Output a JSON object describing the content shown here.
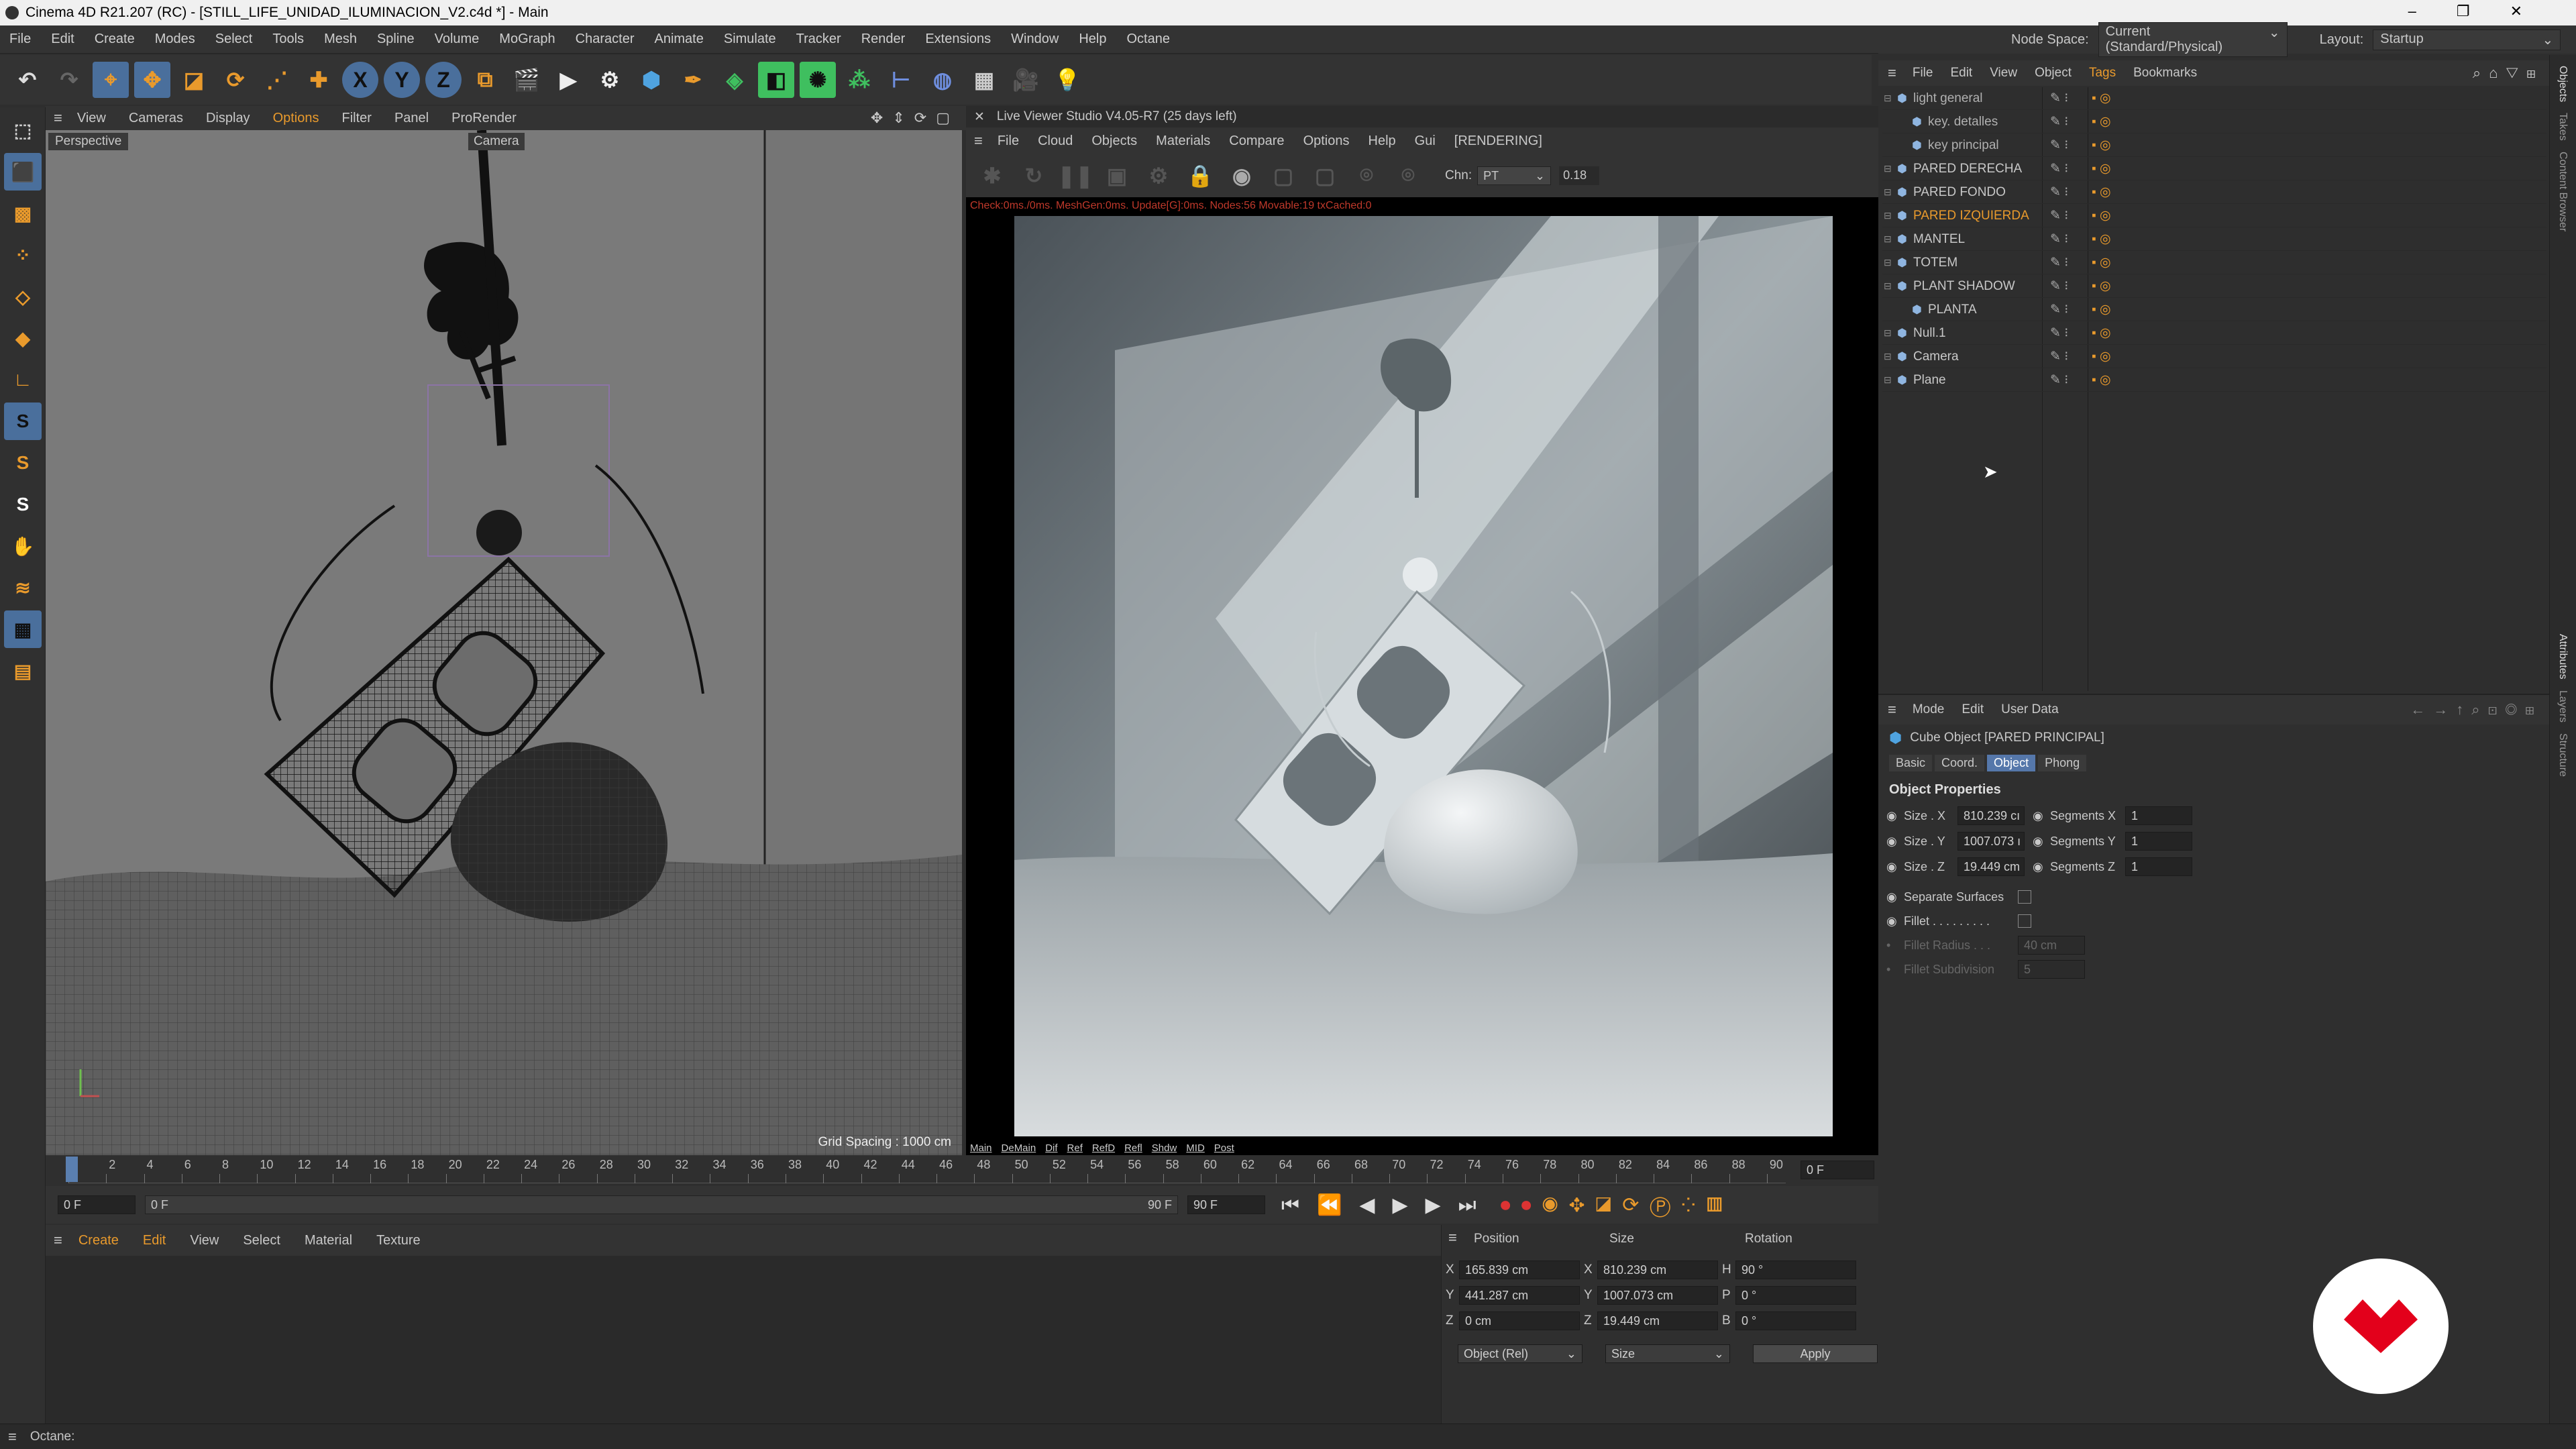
{
  "app": {
    "title": "Cinema 4D R21.207 (RC) - [STILL_LIFE_UNIDAD_ILUMINACION_V2.c4d *] - Main",
    "window_buttons": [
      "–",
      "❐",
      "✕"
    ]
  },
  "menu": [
    "File",
    "Edit",
    "Create",
    "Modes",
    "Select",
    "Tools",
    "Mesh",
    "Spline",
    "Volume",
    "MoGraph",
    "Character",
    "Animate",
    "Simulate",
    "Tracker",
    "Render",
    "Extensions",
    "Window",
    "Help",
    "Octane"
  ],
  "node_space": {
    "label": "Node Space:",
    "value": "Current (Standard/Physical)",
    "layout_label": "Layout:",
    "layout_value": "Startup"
  },
  "viewport": {
    "menu": [
      "View",
      "Cameras",
      "Display",
      "Options",
      "Filter",
      "Panel",
      "ProRender"
    ],
    "label": "Perspective",
    "camera": "Camera",
    "grid_spacing": "Grid Spacing : 1000 cm"
  },
  "live_viewer": {
    "title": "Live Viewer Studio V4.05-R7 (25 days left)",
    "menu": [
      "File",
      "Cloud",
      "Objects",
      "Materials",
      "Compare",
      "Options",
      "Help",
      "Gui"
    ],
    "status": "[RENDERING]",
    "chn_label": "Chn:",
    "chn_value": "PT",
    "gamma": "0.18",
    "stats": "Check:0ms./0ms. MeshGen:0ms. Update[G]:0ms. Nodes:56 Movable:19 txCached:0",
    "passes": [
      "Main",
      "DeMain",
      "Dif",
      "Ref",
      "RefD",
      "Refl",
      "Shdw",
      "MID",
      "Post"
    ]
  },
  "timeline": {
    "ticks": [
      "0",
      "2",
      "4",
      "6",
      "8",
      "10",
      "12",
      "14",
      "16",
      "18",
      "20",
      "22",
      "24",
      "26",
      "28",
      "30",
      "32",
      "34",
      "36",
      "38",
      "40",
      "42",
      "44",
      "46",
      "48",
      "50",
      "52",
      "54",
      "56",
      "58",
      "60",
      "62",
      "64",
      "66",
      "68",
      "70",
      "72",
      "74",
      "76",
      "78",
      "80",
      "82",
      "84",
      "86",
      "88",
      "90"
    ],
    "current_frame": "0 F",
    "start": "0 F",
    "range_start": "0 F",
    "range_end": "90 F",
    "end": "90 F"
  },
  "material_menu": [
    "Create",
    "Edit",
    "View",
    "Select",
    "Material",
    "Texture"
  ],
  "coords": {
    "headers": [
      "Position",
      "Size",
      "Rotation"
    ],
    "rows": [
      {
        "axis": "X",
        "pos": "165.839 cm",
        "size_axis": "X",
        "size": "810.239 cm",
        "rot_axis": "H",
        "rot": "90 °"
      },
      {
        "axis": "Y",
        "pos": "441.287 cm",
        "size_axis": "Y",
        "size": "1007.073 cm",
        "rot_axis": "P",
        "rot": "0 °"
      },
      {
        "axis": "Z",
        "pos": "0 cm",
        "size_axis": "Z",
        "size": "19.449 cm",
        "rot_axis": "B",
        "rot": "0 °"
      }
    ],
    "mode": "Object (Rel)",
    "size_mode": "Size",
    "apply": "Apply"
  },
  "status": "Octane:",
  "objects": {
    "menu": [
      "File",
      "Edit",
      "View",
      "Object",
      "Tags",
      "Bookmarks"
    ],
    "items": [
      {
        "name": "light general",
        "indent": 0,
        "color": "#b0b0b0"
      },
      {
        "name": "key. detalles",
        "indent": 1,
        "color": "#b0b0b0"
      },
      {
        "name": "key principal",
        "indent": 1,
        "color": "#b0b0b0"
      },
      {
        "name": "PARED DERECHA",
        "indent": 0,
        "color": "#c8c8c8"
      },
      {
        "name": "PARED FONDO",
        "indent": 0,
        "color": "#c8c8c8"
      },
      {
        "name": "PARED IZQUIERDA",
        "indent": 0,
        "color": "#e99a2c"
      },
      {
        "name": "MANTEL",
        "indent": 0,
        "color": "#c8c8c8"
      },
      {
        "name": "TOTEM",
        "indent": 0,
        "color": "#c8c8c8"
      },
      {
        "name": "PLANT SHADOW",
        "indent": 0,
        "color": "#c8c8c8"
      },
      {
        "name": "PLANTA",
        "indent": 1,
        "color": "#c8c8c8"
      },
      {
        "name": "Null.1",
        "indent": 0,
        "color": "#c8c8c8"
      },
      {
        "name": "Camera",
        "indent": 0,
        "color": "#c8c8c8"
      },
      {
        "name": "Plane",
        "indent": 0,
        "color": "#c8c8c8"
      }
    ]
  },
  "attributes": {
    "menu": [
      "Mode",
      "Edit",
      "User Data"
    ],
    "object_title": "Cube Object [PARED PRINCIPAL]",
    "tabs": [
      "Basic",
      "Coord.",
      "Object",
      "Phong"
    ],
    "active_tab": "Object",
    "section": "Object Properties",
    "fields": [
      {
        "label": "Size . X",
        "value": "810.239 cı",
        "seg_label": "Segments X",
        "seg": "1"
      },
      {
        "label": "Size . Y",
        "value": "1007.073 ı",
        "seg_label": "Segments Y",
        "seg": "1"
      },
      {
        "label": "Size . Z",
        "value": "19.449 cm",
        "seg_label": "Segments Z",
        "seg": "1"
      }
    ],
    "separate_surfaces": "Separate Surfaces",
    "fillet": "Fillet . . . . . . . . .",
    "fillet_radius": "Fillet Radius . . .",
    "fillet_radius_value": "40 cm",
    "fillet_subdivision": "Fillet Subdivision",
    "fillet_subdivision_value": "5"
  },
  "side_tabs": [
    "Objects",
    "Takes",
    "Content Browser",
    "Attributes",
    "Layers",
    "Structure"
  ],
  "colors": {
    "accent": "#e99a2c",
    "brand": "#e3001b"
  }
}
